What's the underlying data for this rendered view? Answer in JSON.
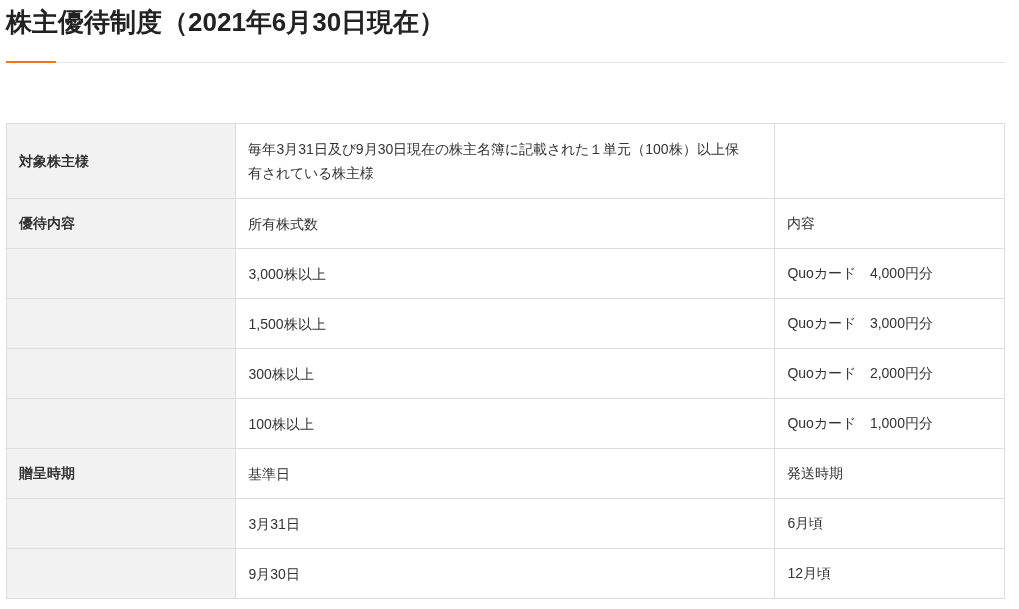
{
  "title": "株主優待制度（2021年6月30日現在）",
  "table": {
    "rows": [
      {
        "label": "対象株主様",
        "value": "毎年3月31日及び9月30日現在の株主名簿に記載された１単元（100株）以上保有されている株主様"
      },
      {
        "label": "優待内容",
        "value": "所有株式数",
        "detail": "内容"
      },
      {
        "value": "3,000株以上",
        "detail": "Quoカード　4,000円分"
      },
      {
        "value": "1,500株以上",
        "detail": "Quoカード　3,000円分"
      },
      {
        "value": "300株以上",
        "detail": "Quoカード　2,000円分"
      },
      {
        "value": "100株以上",
        "detail": "Quoカード　1,000円分"
      },
      {
        "label": "贈呈時期",
        "value": "基準日",
        "detail": "発送時期"
      },
      {
        "value": "3月31日",
        "detail": "6月頃"
      },
      {
        "value": "9月30日",
        "detail": "12月頃"
      }
    ]
  }
}
